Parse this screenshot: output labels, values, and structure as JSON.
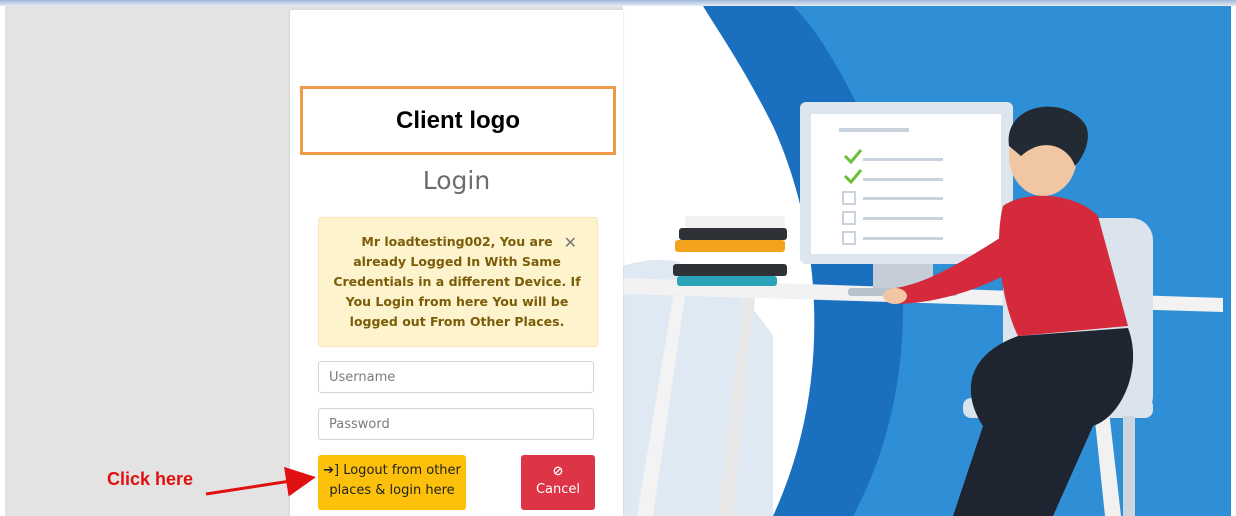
{
  "logo": {
    "text": "Client logo"
  },
  "login": {
    "title": "Login",
    "alert": {
      "message": "Mr loadtesting002, You are already Logged In With Same Credentials in a different Device. If You Login from here You will be logged out From Other Places.",
      "close_icon": "close-icon"
    },
    "username_placeholder": "Username",
    "password_placeholder": "Password",
    "logout_button": {
      "icon": "sign-in-icon",
      "label": "Logout from other places & login here"
    },
    "cancel_button": {
      "icon": "ban-icon",
      "label": "Cancel"
    }
  },
  "annotation": {
    "text": "Click here",
    "color": "#e01010"
  },
  "colors": {
    "accent_yellow": "#fdc10b",
    "danger_red": "#dd3546",
    "logo_border": "#ef9a4a",
    "alert_bg": "#fdf3cd",
    "illustration_blue": "#1e73be"
  }
}
